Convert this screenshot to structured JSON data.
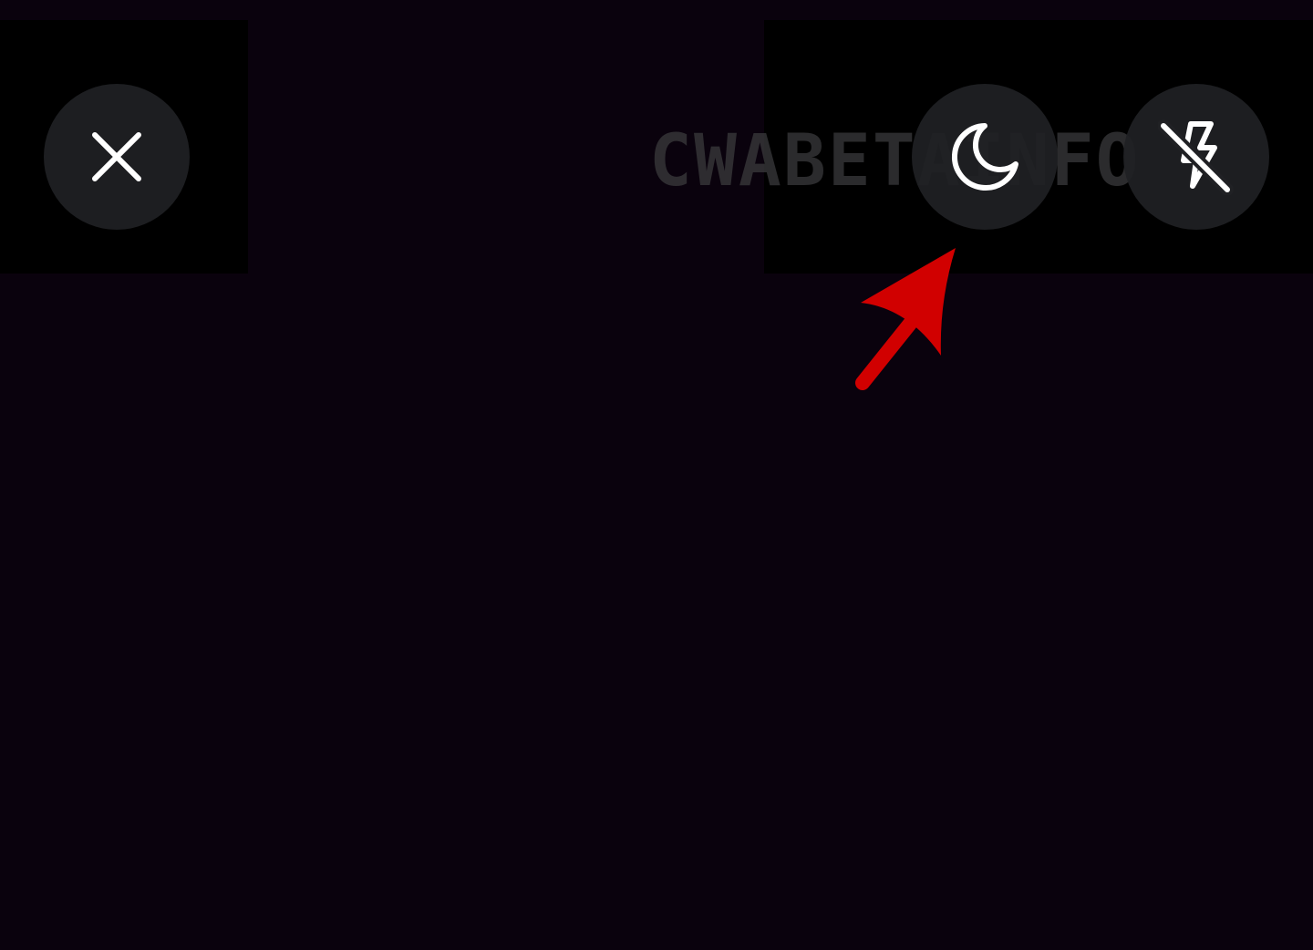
{
  "watermark": {
    "text": "CWABETAINFO"
  },
  "controls": {
    "close": {
      "icon": "close-icon"
    },
    "night_mode": {
      "icon": "moon-icon"
    },
    "flash": {
      "icon": "flash-off-icon"
    }
  },
  "annotation": {
    "icon": "red-arrow",
    "color": "#d10000"
  },
  "colors": {
    "background": "#0a020d",
    "panel": "#000000",
    "button": "#202124",
    "icon": "#ffffff"
  }
}
